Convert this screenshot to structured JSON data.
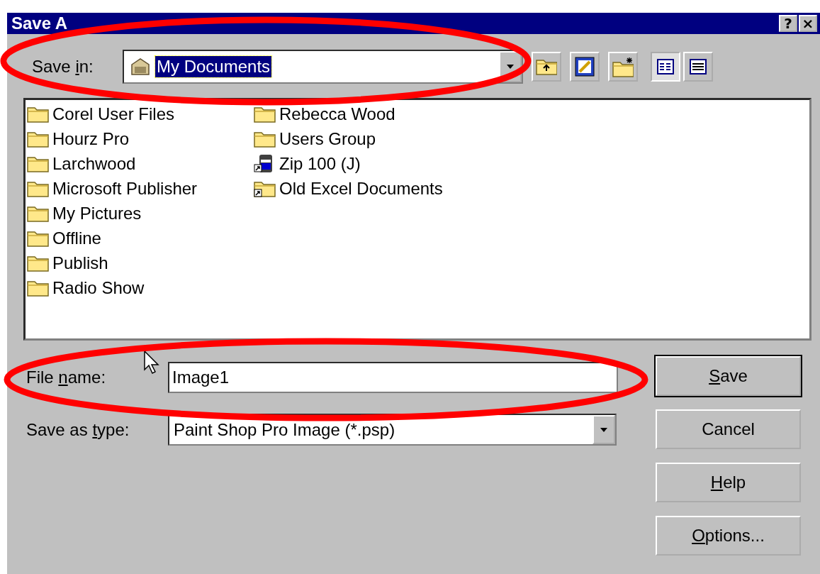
{
  "window": {
    "title": "Save A",
    "help_button": "?",
    "close_button": "×"
  },
  "save_in": {
    "label": {
      "before": "Save ",
      "key": "i",
      "after": "n:"
    },
    "value": "My Documents",
    "selected": true
  },
  "views": [
    {
      "kind": "list",
      "selected": true
    },
    {
      "kind": "details",
      "selected": false
    }
  ],
  "files": [
    {
      "name": "Corel User Files",
      "kind": "folder"
    },
    {
      "name": "Hourz Pro",
      "kind": "folder"
    },
    {
      "name": "Larchwood",
      "kind": "folder"
    },
    {
      "name": "Microsoft Publisher",
      "kind": "folder"
    },
    {
      "name": "My Pictures",
      "kind": "folder"
    },
    {
      "name": "Offline",
      "kind": "folder"
    },
    {
      "name": "Publish",
      "kind": "folder"
    },
    {
      "name": "Radio Show",
      "kind": "folder"
    },
    {
      "name": "Rebecca Wood",
      "kind": "folder"
    },
    {
      "name": "Users Group",
      "kind": "folder"
    },
    {
      "name": "Zip 100 (J)",
      "kind": "drive"
    },
    {
      "name": "Old Excel Documents",
      "kind": "shortcut"
    }
  ],
  "file_name": {
    "label": {
      "before": "File ",
      "key": "n",
      "after": "ame:"
    },
    "value": "Image1"
  },
  "save_as_type": {
    "label": {
      "before": "Save as ",
      "key": "t",
      "after": "ype:"
    },
    "value": "Paint Shop Pro Image (*.psp)"
  },
  "buttons": [
    {
      "label": {
        "key": "S",
        "after": "ave"
      },
      "default": true
    },
    {
      "label": {
        "before": "Cancel"
      },
      "default": false
    },
    {
      "label": {
        "key": "H",
        "after": "elp"
      },
      "default": false
    },
    {
      "label": {
        "key": "O",
        "after": "ptions..."
      },
      "default": false
    }
  ],
  "annotations": [
    {
      "kind": "ellipse"
    },
    {
      "kind": "ellipse"
    }
  ]
}
